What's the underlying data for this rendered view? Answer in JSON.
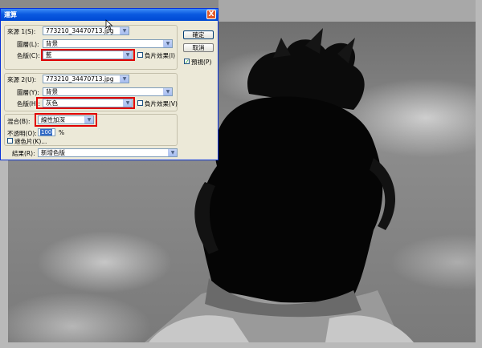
{
  "dialog": {
    "title": "運算",
    "close_label": "X",
    "ok_label": "確定",
    "cancel_label": "取消",
    "preview_label": "預視(P)",
    "preview_checked": true
  },
  "source1": {
    "label": "來源 1(S):",
    "file": "773210_34470713.jpg",
    "layer_label": "圖層(L):",
    "layer": "背景",
    "channel_label": "色版(C):",
    "channel": "藍",
    "invert_label": "負片效果(I)"
  },
  "source2": {
    "label": "來源 2(U):",
    "file": "773210_34470713.jpg",
    "layer_label": "圖層(Y):",
    "layer": "背景",
    "channel_label": "色版(H):",
    "channel": "灰色",
    "invert_label": "負片效果(V)"
  },
  "blending": {
    "label": "混合(B):",
    "mode": "線性加深",
    "opacity_label": "不透明(O):",
    "opacity": "100",
    "opacity_unit": "%",
    "mask_label": "遮色片(K)..."
  },
  "result": {
    "label": "結果(R):",
    "value": "新增色版"
  },
  "colors": {
    "highlight": "#e00000",
    "titlebar": "#0a5ae0"
  }
}
